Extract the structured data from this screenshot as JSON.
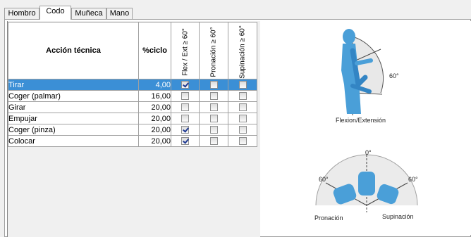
{
  "tabs": [
    {
      "label": "Hombro",
      "active": false
    },
    {
      "label": "Codo",
      "active": true
    },
    {
      "label": "Muñeca",
      "active": false
    },
    {
      "label": "Mano",
      "active": false
    }
  ],
  "table": {
    "headers": {
      "action": "Acción técnica",
      "cycle": "%ciclo",
      "flex": "Flex / Ext ≥ 60°",
      "pronation": "Pronación ≥ 60°",
      "supination": "Supinación ≥ 60°"
    },
    "rows": [
      {
        "action": "Tirar",
        "cycle": "4,00",
        "flex": true,
        "pronation": false,
        "supination": false,
        "selected": true
      },
      {
        "action": "Coger (palmar)",
        "cycle": "16,00",
        "flex": false,
        "pronation": false,
        "supination": false,
        "selected": false
      },
      {
        "action": "Girar",
        "cycle": "20,00",
        "flex": false,
        "pronation": false,
        "supination": false,
        "selected": false
      },
      {
        "action": "Empujar",
        "cycle": "20,00",
        "flex": false,
        "pronation": false,
        "supination": false,
        "selected": false
      },
      {
        "action": "Coger (pinza)",
        "cycle": "20,00",
        "flex": true,
        "pronation": false,
        "supination": false,
        "selected": false
      },
      {
        "action": "Colocar",
        "cycle": "20,00",
        "flex": true,
        "pronation": false,
        "supination": false,
        "selected": false
      }
    ]
  },
  "illustrations": {
    "flexion": {
      "caption": "Flexion/Extensión",
      "angle": "60°"
    },
    "rotation": {
      "top": "0°",
      "left_angle": "60°",
      "right_angle": "60°",
      "left_caption": "Pronación",
      "right_caption": "Supinación"
    }
  },
  "colors": {
    "selection": "#3b8fd6",
    "figure": "#4a9fd8"
  }
}
